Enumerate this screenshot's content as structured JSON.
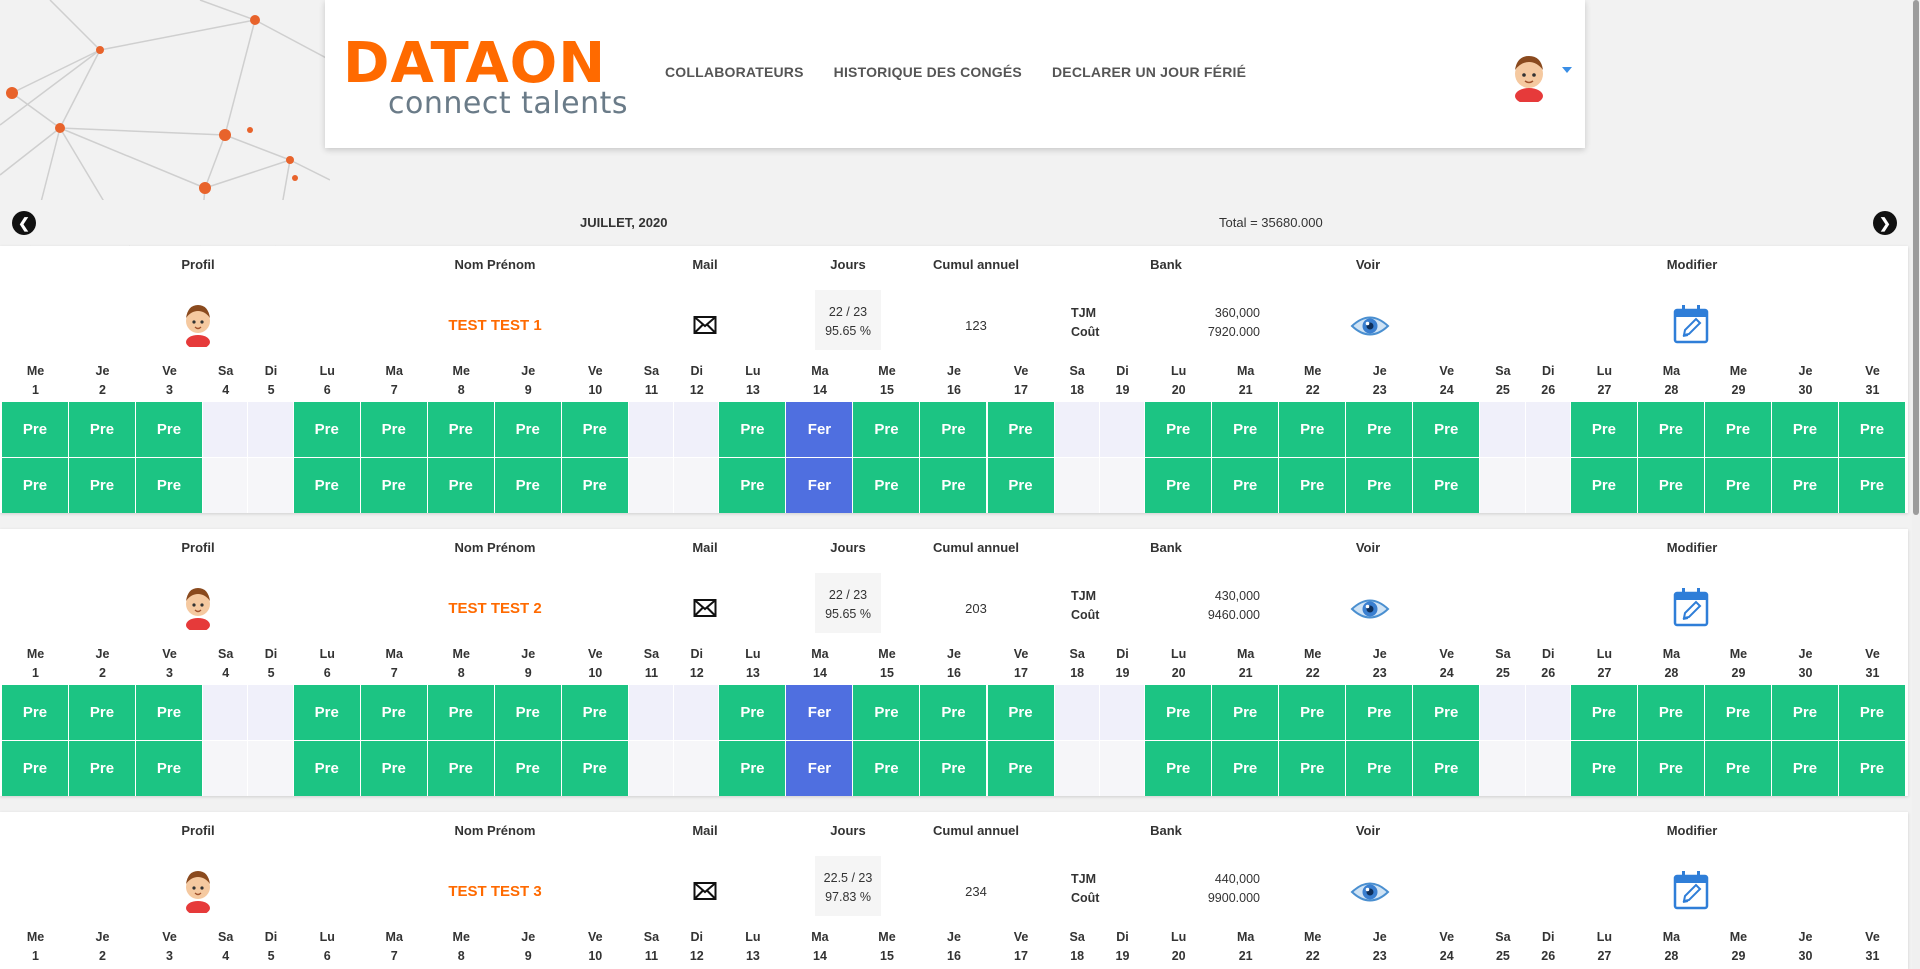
{
  "header": {
    "logo_word": "DATAON",
    "logo_tagline": "connect talents",
    "nav": [
      "COLLABORATEURS",
      "HISTORIQUE DES CONGÉS",
      "DECLARER UN JOUR FÉRIÉ"
    ]
  },
  "calendar": {
    "month_label": "JUILLET, 2020",
    "total_label": "Total = 35680.000",
    "prev_icon": "chevron-left-icon",
    "next_icon": "chevron-right-icon"
  },
  "columns": {
    "profil": "Profil",
    "nom": "Nom Prénom",
    "mail": "Mail",
    "jours": "Jours",
    "cumul": "Cumul annuel",
    "bank": "Bank",
    "voir": "Voir",
    "modifier": "Modifier"
  },
  "bank_labels": {
    "tjm": "TJM",
    "cout": "Coût"
  },
  "days": [
    {
      "d": "Me",
      "n": "1"
    },
    {
      "d": "Je",
      "n": "2"
    },
    {
      "d": "Ve",
      "n": "3"
    },
    {
      "d": "Sa",
      "n": "4"
    },
    {
      "d": "Di",
      "n": "5"
    },
    {
      "d": "Lu",
      "n": "6"
    },
    {
      "d": "Ma",
      "n": "7"
    },
    {
      "d": "Me",
      "n": "8"
    },
    {
      "d": "Je",
      "n": "9"
    },
    {
      "d": "Ve",
      "n": "10"
    },
    {
      "d": "Sa",
      "n": "11"
    },
    {
      "d": "Di",
      "n": "12"
    },
    {
      "d": "Lu",
      "n": "13"
    },
    {
      "d": "Ma",
      "n": "14"
    },
    {
      "d": "Me",
      "n": "15"
    },
    {
      "d": "Je",
      "n": "16"
    },
    {
      "d": "Ve",
      "n": "17"
    },
    {
      "d": "Sa",
      "n": "18"
    },
    {
      "d": "Di",
      "n": "19"
    },
    {
      "d": "Lu",
      "n": "20"
    },
    {
      "d": "Ma",
      "n": "21"
    },
    {
      "d": "Me",
      "n": "22"
    },
    {
      "d": "Je",
      "n": "23"
    },
    {
      "d": "Ve",
      "n": "24"
    },
    {
      "d": "Sa",
      "n": "25"
    },
    {
      "d": "Di",
      "n": "26"
    },
    {
      "d": "Lu",
      "n": "27"
    },
    {
      "d": "Ma",
      "n": "28"
    },
    {
      "d": "Me",
      "n": "29"
    },
    {
      "d": "Je",
      "n": "30"
    },
    {
      "d": "Ve",
      "n": "31"
    }
  ],
  "status_rows": [
    [
      "Pre",
      "Pre",
      "Pre",
      "",
      "",
      "Pre",
      "Pre",
      "Pre",
      "Pre",
      "Pre",
      "",
      "",
      "Pre",
      "Fer",
      "Pre",
      "Pre",
      "Pre",
      "",
      "",
      "Pre",
      "Pre",
      "Pre",
      "Pre",
      "Pre",
      "",
      "",
      "Pre",
      "Pre",
      "Pre",
      "Pre",
      "Pre"
    ],
    [
      "Pre",
      "Pre",
      "Pre",
      "",
      "",
      "Pre",
      "Pre",
      "Pre",
      "Pre",
      "Pre",
      "",
      "",
      "Pre",
      "Fer",
      "Pre",
      "Pre",
      "Pre",
      "",
      "",
      "Pre",
      "Pre",
      "Pre",
      "Pre",
      "Pre",
      "",
      "",
      "Pre",
      "Pre",
      "Pre",
      "Pre",
      "Pre"
    ]
  ],
  "employees": [
    {
      "name": "TEST TEST 1",
      "jours": "22 / 23",
      "jours_pct": "95.65 %",
      "cumul": "123",
      "tjm": "360,000",
      "cout": "7920.000"
    },
    {
      "name": "TEST TEST 2",
      "jours": "22 / 23",
      "jours_pct": "95.65 %",
      "cumul": "203",
      "tjm": "430,000",
      "cout": "9460.000"
    },
    {
      "name": "TEST TEST 3",
      "jours": "22.5 / 23",
      "jours_pct": "97.83 %",
      "cumul": "234",
      "tjm": "440,000",
      "cout": "9900.000"
    }
  ],
  "colors": {
    "present": "#1cc483",
    "ferie": "#4f6fe0",
    "accent": "#ff6a00"
  }
}
